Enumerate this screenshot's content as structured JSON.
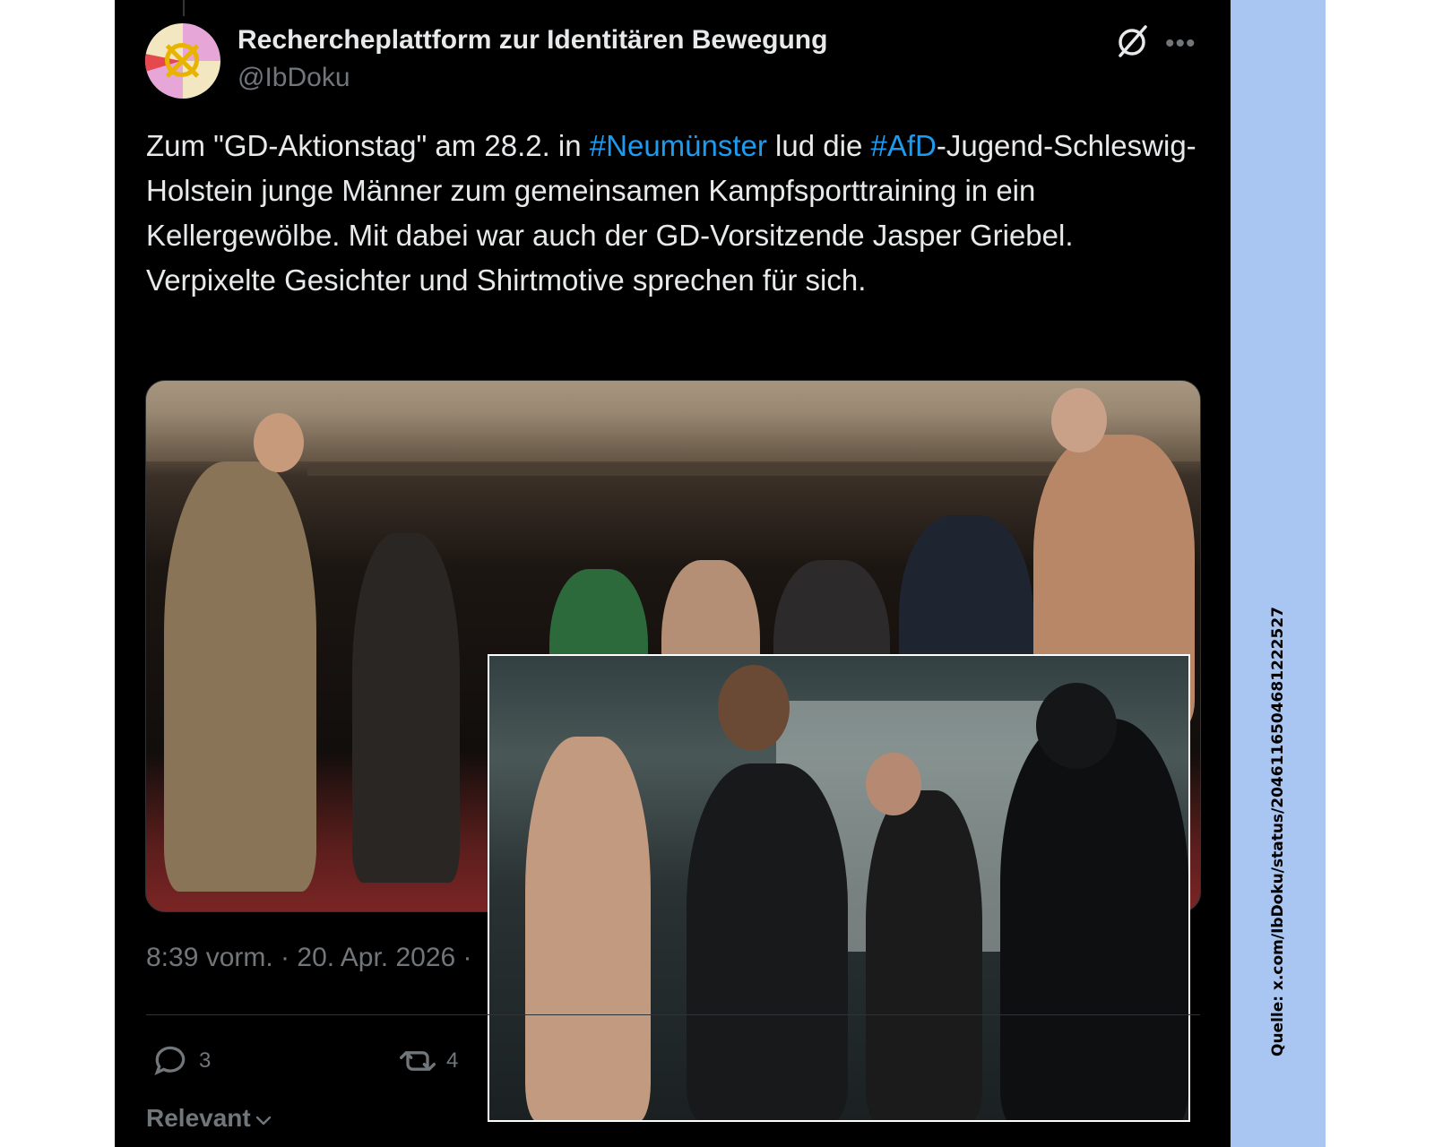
{
  "author": {
    "name": "Rechercheplattform zur Identitären Bewegung",
    "handle": "@IbDoku"
  },
  "tweet": {
    "text_parts": [
      {
        "text": "Zum \"GD-Aktionstag\" am 28.2. in ",
        "type": "plain"
      },
      {
        "text": "#Neumünster",
        "type": "hashtag"
      },
      {
        "text": " lud die ",
        "type": "plain"
      },
      {
        "text": "#AfD",
        "type": "hashtag"
      },
      {
        "text": "-Jugend-Schleswig-Holstein junge Männer zum gemeinsamen Kampfsporttraining in ein Kellergewölbe. Mit dabei war auch der GD-Vorsitzende Jasper Griebel. Verpixelte Gesichter und Shirtmotive sprechen für sich.",
        "type": "plain"
      }
    ],
    "timestamp": "8:39 vorm. · 20. Apr. 2026 ·"
  },
  "actions": {
    "reply_count": "3",
    "retweet_count": "4"
  },
  "sort_label": "Relevant",
  "source_caption": "Quelle: x.com/IbDoku/status/2046116504681222527",
  "colors": {
    "background": "#000000",
    "text": "#e7e9ea",
    "muted": "#71767b",
    "link": "#1d9bf0",
    "source_strip": "#a9c6f2"
  },
  "icons": {
    "grok": "grok-icon",
    "more": "more-icon",
    "reply": "reply-icon",
    "retweet": "retweet-icon",
    "chevron": "chevron-down-icon"
  }
}
